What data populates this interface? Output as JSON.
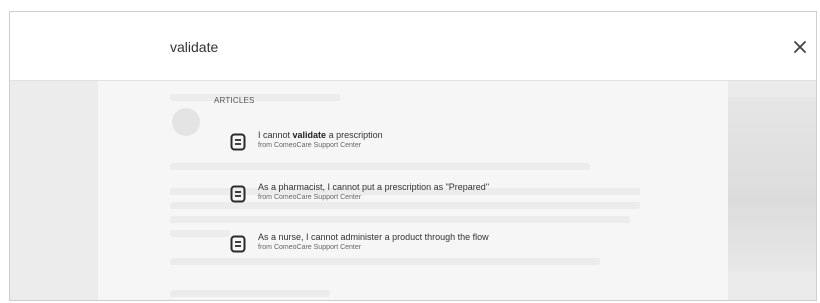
{
  "search": {
    "query": "validate"
  },
  "results": {
    "section_label": "ARTICLES",
    "items": [
      {
        "title_before": "I cannot ",
        "title_highlight": "validate",
        "title_after": " a prescription",
        "source": "from ComeoCare Support Center"
      },
      {
        "title_before": "As a pharmacist, I cannot put a prescription as \"Prepared\"",
        "title_highlight": "",
        "title_after": "",
        "source": "from ComeoCare Support Center"
      },
      {
        "title_before": "As a nurse, I cannot administer a product through the flow",
        "title_highlight": "",
        "title_after": "",
        "source": "from ComeoCare Support Center"
      }
    ]
  },
  "icons": {
    "close": "close-icon",
    "article": "article-icon"
  },
  "colors": {
    "text": "#333333",
    "muted": "#666666",
    "icon": "#2b2b2b"
  }
}
